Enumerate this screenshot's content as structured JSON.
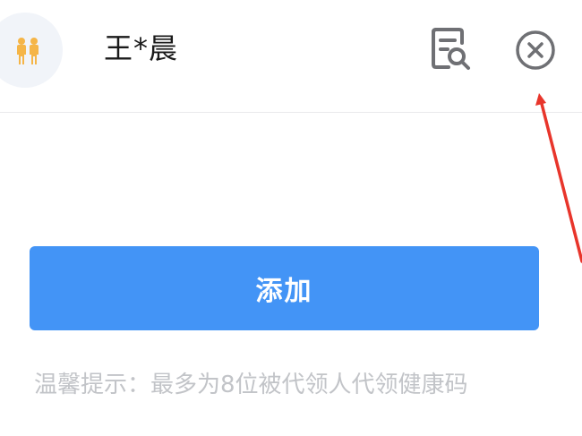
{
  "header": {
    "avatar_icon": "family-icon",
    "name": "王*晨",
    "detail_icon": "document-search-icon",
    "close_icon": "close-circle-icon"
  },
  "main": {
    "add_label": "添加",
    "tip": "温馨提示：最多为8位被代领人代领健康码"
  },
  "colors": {
    "primary": "#4394f6",
    "avatar_bg": "#f1f4f9",
    "avatar_figure": "#f5b547",
    "icon_gray": "#6f7074",
    "tip_text": "#c2c4c8",
    "annotation_red": "#e8352b"
  }
}
